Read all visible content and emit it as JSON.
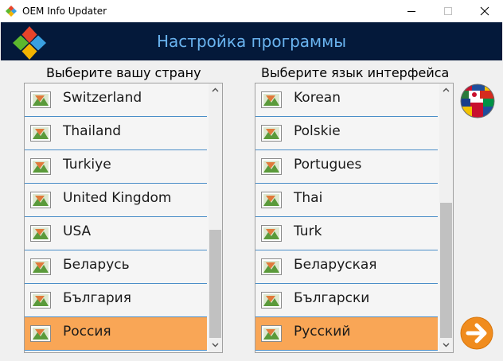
{
  "window": {
    "title": "OEM Info Updater",
    "controls": [
      "minimize",
      "maximize",
      "close"
    ]
  },
  "header": {
    "title": "Настройка программы",
    "background": "#04193a",
    "title_color": "#6ab4f0"
  },
  "country_list": {
    "label": "Выберите вашу страну",
    "items": [
      {
        "label": "Switzerland",
        "icon": "flag-placeholder-icon"
      },
      {
        "label": "Thailand",
        "icon": "flag-placeholder-icon"
      },
      {
        "label": "Turkiye",
        "icon": "flag-placeholder-icon"
      },
      {
        "label": "United Kingdom",
        "icon": "flag-placeholder-icon"
      },
      {
        "label": "USA",
        "icon": "flag-placeholder-icon"
      },
      {
        "label": "Беларусь",
        "icon": "flag-placeholder-icon"
      },
      {
        "label": "България",
        "icon": "flag-placeholder-icon"
      },
      {
        "label": "Россия",
        "icon": "flag-placeholder-icon"
      }
    ],
    "selected": "Россия"
  },
  "language_list": {
    "label": "Выберите язык интерфейса",
    "items": [
      {
        "label": "Korean",
        "icon": "flag-placeholder-icon"
      },
      {
        "label": "Polskie",
        "icon": "flag-placeholder-icon"
      },
      {
        "label": "Portugues",
        "icon": "flag-placeholder-icon"
      },
      {
        "label": "Thai",
        "icon": "flag-placeholder-icon"
      },
      {
        "label": "Turk",
        "icon": "flag-placeholder-icon"
      },
      {
        "label": "Беларуская",
        "icon": "flag-placeholder-icon"
      },
      {
        "label": "Български",
        "icon": "flag-placeholder-icon"
      },
      {
        "label": "Русский",
        "icon": "flag-placeholder-icon"
      }
    ],
    "selected": "Русский"
  },
  "colors": {
    "selection": "#f9a656",
    "row_separator": "#4a8ec8",
    "next_button": "#f08c1e"
  },
  "icons": {
    "app": "windows-logo-icon",
    "globe": "flags-globe-icon",
    "next": "arrow-right-icon"
  }
}
